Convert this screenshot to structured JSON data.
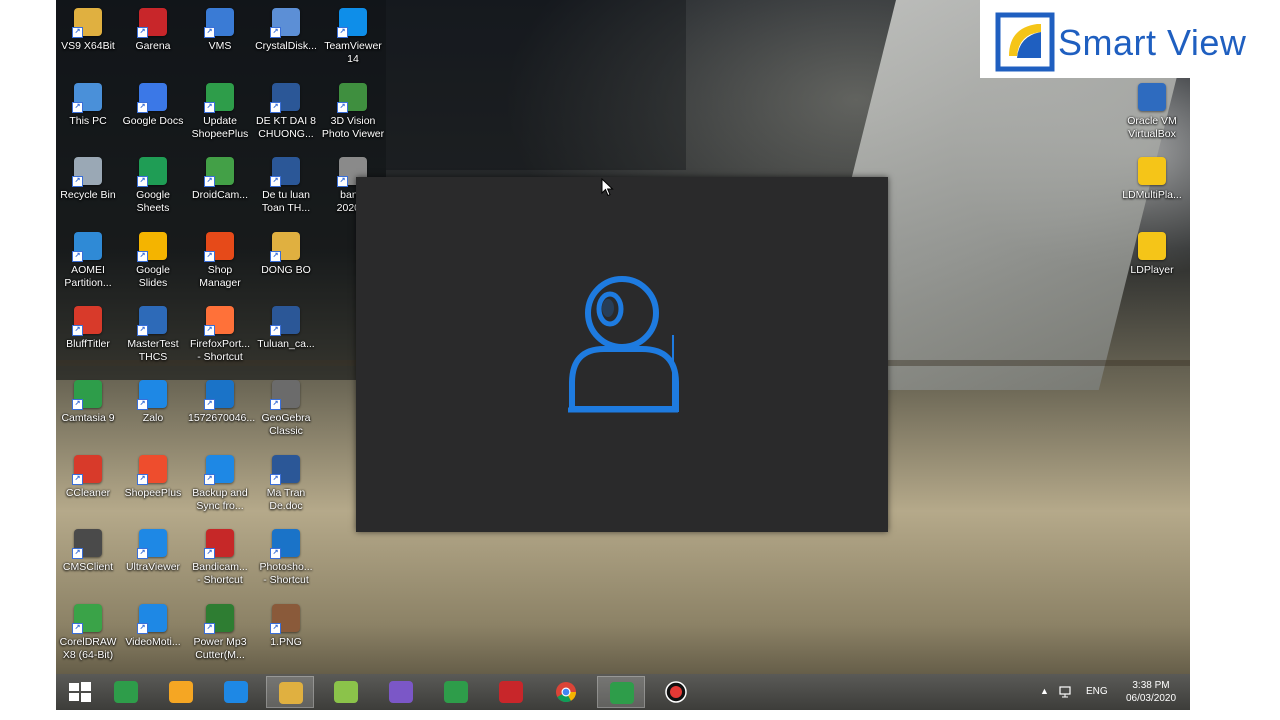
{
  "brand": {
    "name": "Smart View"
  },
  "desktop": {
    "icons_col1": [
      {
        "label": "VS9 X64Bit",
        "icon": "folder-icon",
        "color": "#e0b040"
      },
      {
        "label": "This PC",
        "icon": "computer-icon",
        "color": "#4a90d9"
      },
      {
        "label": "Recycle Bin",
        "icon": "recycle-bin-icon",
        "color": "#9aa8b5"
      },
      {
        "label": "AOMEI\nPartition...",
        "icon": "aomei-icon",
        "color": "#2f8ad6"
      },
      {
        "label": "BluffTitler",
        "icon": "blufftitler-icon",
        "color": "#d83a2a"
      },
      {
        "label": "Camtasia 9",
        "icon": "camtasia-icon",
        "color": "#2e9d4a"
      },
      {
        "label": "CCleaner",
        "icon": "ccleaner-icon",
        "color": "#d83a2a"
      },
      {
        "label": "CMSClient",
        "icon": "cmsclient-icon",
        "color": "#4a4a4a"
      },
      {
        "label": "CorelDRAW\nX8 (64-Bit)",
        "icon": "coreldraw-icon",
        "color": "#3aa348"
      }
    ],
    "icons_col2": [
      {
        "label": "Garena",
        "icon": "garena-icon",
        "color": "#c8262a"
      },
      {
        "label": "Google Docs",
        "icon": "google-docs-icon",
        "color": "#3b78e7"
      },
      {
        "label": "Google\nSheets",
        "icon": "google-sheets-icon",
        "color": "#1f9d55"
      },
      {
        "label": "Google Slides",
        "icon": "google-slides-icon",
        "color": "#f4b400"
      },
      {
        "label": "MasterTest\nTHCS",
        "icon": "mastertest-icon",
        "color": "#2d6ab8"
      },
      {
        "label": "Zalo",
        "icon": "zalo-icon",
        "color": "#1e88e5"
      },
      {
        "label": "ShopeePlus",
        "icon": "shopeeplus-icon",
        "color": "#ee4d2d"
      },
      {
        "label": "UltraViewer",
        "icon": "ultraviewer-icon",
        "color": "#1e88e5"
      },
      {
        "label": "VideoMoti...",
        "icon": "videomotion-icon",
        "color": "#1e88e5"
      }
    ],
    "icons_col3": [
      {
        "label": "VMS",
        "icon": "vms-icon",
        "color": "#3a7bd5"
      },
      {
        "label": "Update\nShopeePlus",
        "icon": "update-shopeeplus-icon",
        "color": "#2e9d4a"
      },
      {
        "label": "DroidCam...",
        "icon": "droidcam-icon",
        "color": "#43a047"
      },
      {
        "label": "Shop\nManager",
        "icon": "shop-manager-icon",
        "color": "#e64a19"
      },
      {
        "label": "FirefoxPort...\n- Shortcut",
        "icon": "firefox-icon",
        "color": "#ff7139"
      },
      {
        "label": "1572670046...",
        "icon": "photoshop-file-icon",
        "color": "#1a73c8"
      },
      {
        "label": "Backup and\nSync fro...",
        "icon": "backup-sync-icon",
        "color": "#1e88e5"
      },
      {
        "label": "Bandicam...\n- Shortcut",
        "icon": "bandicam-icon",
        "color": "#c62828"
      },
      {
        "label": "Power Mp3\nCutter(M...",
        "icon": "mp3-cutter-icon",
        "color": "#2e7d32"
      }
    ],
    "icons_col4": [
      {
        "label": "CrystalDisk...",
        "icon": "crystaldisk-icon",
        "color": "#5c8fd6"
      },
      {
        "label": "DE KT DAI 8\nCHUONG...",
        "icon": "word-doc-icon",
        "color": "#2b5797"
      },
      {
        "label": "De tu luan\nToan TH...",
        "icon": "word-doc-icon",
        "color": "#2b5797"
      },
      {
        "label": "DONG BO",
        "icon": "folder-icon",
        "color": "#e0b040"
      },
      {
        "label": "Tuluan_ca...",
        "icon": "word-doc-icon",
        "color": "#2b5797"
      },
      {
        "label": "GeoGebra\nClassic",
        "icon": "geogebra-icon",
        "color": "#6b6b6b"
      },
      {
        "label": "Ma Tran\nDe.doc",
        "icon": "word-doc-icon",
        "color": "#2b5797"
      },
      {
        "label": "Photosho...\n- Shortcut",
        "icon": "photoshop-icon",
        "color": "#1a73c8"
      },
      {
        "label": "1.PNG",
        "icon": "image-file-icon",
        "color": "#8a5a3a"
      }
    ],
    "icons_col5": [
      {
        "label": "TeamViewer\n14",
        "icon": "teamviewer-icon",
        "color": "#0e8ee9"
      },
      {
        "label": "3D Vision\nPhoto Viewer",
        "icon": "3dvision-icon",
        "color": "#3f8f3f"
      },
      {
        "label": "bandi\n2020-0",
        "icon": "bandicam-file-icon",
        "color": "#8a8a8a"
      }
    ],
    "icons_right": [
      {
        "label": "Oracle VM\nVirtualBox",
        "icon": "virtualbox-icon",
        "color": "#2e6bbf"
      },
      {
        "label": "LDMultiPla...",
        "icon": "ldmultiplayer-icon",
        "color": "#f5c518"
      },
      {
        "label": "LDPlayer",
        "icon": "ldplayer-icon",
        "color": "#f5c518"
      }
    ]
  },
  "taskbar": {
    "items": [
      {
        "name": "start-button",
        "icon": "windows-logo-icon",
        "color": "#ffffff"
      },
      {
        "name": "taskbar-app-1",
        "icon": "green-sparkle-icon",
        "color": "#2e9d4a"
      },
      {
        "name": "taskbar-app-2",
        "icon": "power-icon",
        "color": "#f5a623"
      },
      {
        "name": "taskbar-ie",
        "icon": "internet-explorer-icon",
        "color": "#1e88e5"
      },
      {
        "name": "taskbar-explorer",
        "icon": "file-explorer-icon",
        "color": "#e0b040"
      },
      {
        "name": "taskbar-app-6",
        "icon": "green-circle-icon",
        "color": "#8bc34a"
      },
      {
        "name": "taskbar-visual-studio",
        "icon": "visual-studio-icon",
        "color": "#7b57c7"
      },
      {
        "name": "taskbar-store",
        "icon": "windows-store-icon",
        "color": "#2e9d4a"
      },
      {
        "name": "taskbar-garena",
        "icon": "garena-icon",
        "color": "#c8262a"
      },
      {
        "name": "taskbar-chrome",
        "icon": "chrome-icon",
        "color": "#4285f4"
      },
      {
        "name": "taskbar-camtasia",
        "icon": "camtasia-icon",
        "color": "#2e9d4a"
      },
      {
        "name": "taskbar-record",
        "icon": "record-icon",
        "color": "#e53935"
      }
    ],
    "tray": {
      "language": "ENG",
      "time": "3:38 PM",
      "date": "06/03/2020"
    }
  },
  "dialog": {
    "icon": "webcam-user-icon",
    "accent": "#1e7be0"
  }
}
